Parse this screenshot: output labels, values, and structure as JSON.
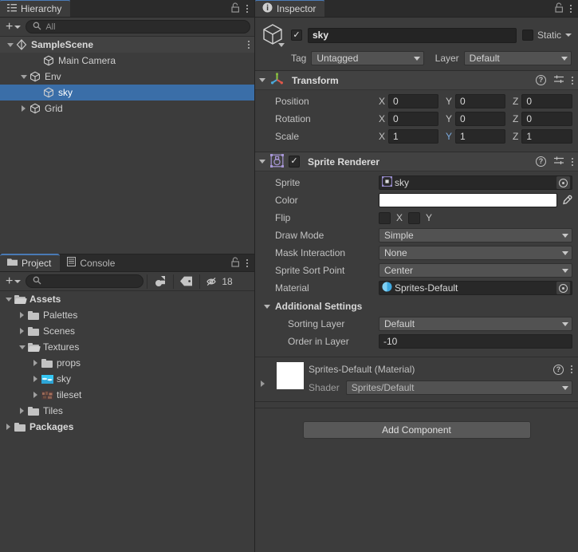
{
  "hierarchy": {
    "tab_label": "Hierarchy",
    "search_placeholder": "All",
    "create_label": "+",
    "items": [
      {
        "label": "SampleScene",
        "icon": "scene-icon",
        "depth": 0,
        "expanded": true,
        "selected": false,
        "bold": true
      },
      {
        "label": "Main Camera",
        "icon": "gameobject-cube-icon",
        "depth": 2,
        "expanded": null,
        "selected": false,
        "bold": false
      },
      {
        "label": "Env",
        "icon": "gameobject-cube-icon",
        "depth": 1,
        "expanded": true,
        "selected": false,
        "bold": false
      },
      {
        "label": "sky",
        "icon": "gameobject-cube-icon",
        "depth": 2,
        "expanded": null,
        "selected": true,
        "bold": false
      },
      {
        "label": "Grid",
        "icon": "gameobject-cube-icon",
        "depth": 1,
        "expanded": false,
        "selected": false,
        "bold": false
      }
    ]
  },
  "project": {
    "tabs": [
      {
        "label": "Project",
        "icon": "folder-icon",
        "active": true
      },
      {
        "label": "Console",
        "icon": "console-icon",
        "active": false
      }
    ],
    "search_placeholder": "",
    "create_label": "+",
    "hidden_count": "18",
    "tree": [
      {
        "label": "Assets",
        "depth": 0,
        "expanded": true,
        "bold": true,
        "icon": "folder-open-icon"
      },
      {
        "label": "Palettes",
        "depth": 1,
        "expanded": false,
        "bold": false,
        "icon": "folder-icon"
      },
      {
        "label": "Scenes",
        "depth": 1,
        "expanded": false,
        "bold": false,
        "icon": "folder-icon"
      },
      {
        "label": "Textures",
        "depth": 1,
        "expanded": true,
        "bold": false,
        "icon": "folder-open-icon"
      },
      {
        "label": "props",
        "depth": 2,
        "expanded": false,
        "bold": false,
        "icon": "folder-icon"
      },
      {
        "label": "sky",
        "depth": 2,
        "expanded": false,
        "bold": false,
        "icon": "texture-sky-thumbnail"
      },
      {
        "label": "tileset",
        "depth": 2,
        "expanded": false,
        "bold": false,
        "icon": "texture-tileset-thumbnail"
      },
      {
        "label": "Tiles",
        "depth": 1,
        "expanded": false,
        "bold": false,
        "icon": "folder-icon"
      },
      {
        "label": "Packages",
        "depth": 0,
        "expanded": false,
        "bold": true,
        "icon": "folder-icon"
      }
    ]
  },
  "inspector": {
    "tab_label": "Inspector",
    "object": {
      "enabled": true,
      "name": "sky",
      "static_label": "Static",
      "static_checked": false,
      "tag_label": "Tag",
      "tag_value": "Untagged",
      "layer_label": "Layer",
      "layer_value": "Default"
    },
    "transform": {
      "title": "Transform",
      "enabled": null,
      "rows": [
        {
          "label": "Position",
          "x": "0",
          "y": "0",
          "z": "0",
          "highlight_axis": ""
        },
        {
          "label": "Rotation",
          "x": "0",
          "y": "0",
          "z": "0",
          "highlight_axis": ""
        },
        {
          "label": "Scale",
          "x": "1",
          "y": "1",
          "z": "1",
          "highlight_axis": "Y"
        }
      ],
      "axis_labels": {
        "x": "X",
        "y": "Y",
        "z": "Z"
      }
    },
    "sprite_renderer": {
      "title": "Sprite Renderer",
      "enabled": true,
      "sprite_label": "Sprite",
      "sprite_value": "sky",
      "color_label": "Color",
      "color_value": "#FFFFFF",
      "flip_label": "Flip",
      "flip_x_label": "X",
      "flip_y_label": "Y",
      "flip_x": false,
      "flip_y": false,
      "draw_mode_label": "Draw Mode",
      "draw_mode_value": "Simple",
      "mask_interaction_label": "Mask Interaction",
      "mask_interaction_value": "None",
      "sort_point_label": "Sprite Sort Point",
      "sort_point_value": "Center",
      "material_label": "Material",
      "material_value": "Sprites-Default",
      "additional_settings_label": "Additional Settings",
      "sorting_layer_label": "Sorting Layer",
      "sorting_layer_value": "Default",
      "order_in_layer_label": "Order in Layer",
      "order_in_layer_value": "-10"
    },
    "material_preview": {
      "title": "Sprites-Default (Material)",
      "shader_label": "Shader",
      "shader_value": "Sprites/Default"
    },
    "add_component_label": "Add Component"
  },
  "colors": {
    "selection_blue": "#3a6ea8",
    "panel_bg": "#3c3c3c",
    "tab_bg": "#2b2b2b",
    "field_bg": "#282828",
    "dropdown_bg": "#525252",
    "accent_axis_highlight": "#7aa9dd",
    "material_white": "#FFFFFF"
  }
}
